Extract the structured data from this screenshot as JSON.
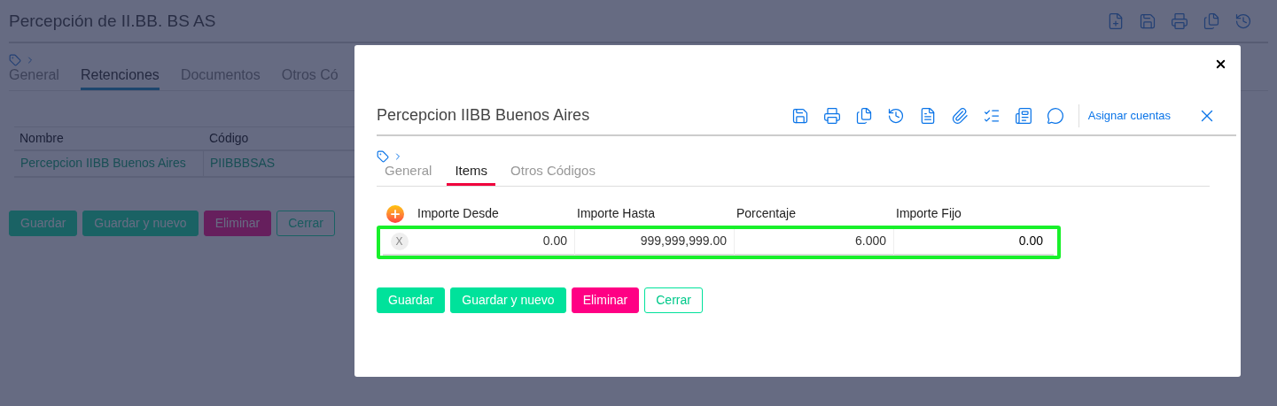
{
  "page": {
    "title": "Percepción de II.BB. BS AS",
    "tabs": [
      {
        "label": "General",
        "selected": false
      },
      {
        "label": "Retenciones",
        "selected": true
      },
      {
        "label": "Documentos",
        "selected": false
      },
      {
        "label": "Otros Có",
        "selected": false
      }
    ],
    "table": {
      "columns": [
        "Nombre",
        "Código"
      ],
      "rows": [
        [
          "Percepcion IIBB Buenos Aires",
          "PIIBBBSAS"
        ]
      ]
    },
    "buttons": [
      {
        "label": "Guardar",
        "kind": "primary"
      },
      {
        "label": "Guardar y nuevo",
        "kind": "primary"
      },
      {
        "label": "Eliminar",
        "kind": "danger"
      },
      {
        "label": "Cerrar",
        "kind": "outline"
      }
    ]
  },
  "modal": {
    "title": "Percepcion IIBB Buenos Aires",
    "link": "Asignar cuentas",
    "tabs": [
      {
        "label": "General",
        "selected": false
      },
      {
        "label": "Items",
        "selected": true
      },
      {
        "label": "Otros Códigos",
        "selected": false
      }
    ],
    "table": {
      "columns": [
        "Importe Desde",
        "Importe Hasta",
        "Porcentaje",
        "Importe Fijo"
      ],
      "rows": [
        {
          "delete": "X",
          "cells": [
            "0.00",
            "999,999,999.00",
            "6.000",
            "0.00"
          ],
          "highlighted": true
        }
      ]
    },
    "buttons": [
      {
        "label": "Guardar",
        "kind": "primary"
      },
      {
        "label": "Guardar y nuevo",
        "kind": "primary"
      },
      {
        "label": "Eliminar",
        "kind": "danger"
      },
      {
        "label": "Cerrar",
        "kind": "outline"
      }
    ]
  }
}
